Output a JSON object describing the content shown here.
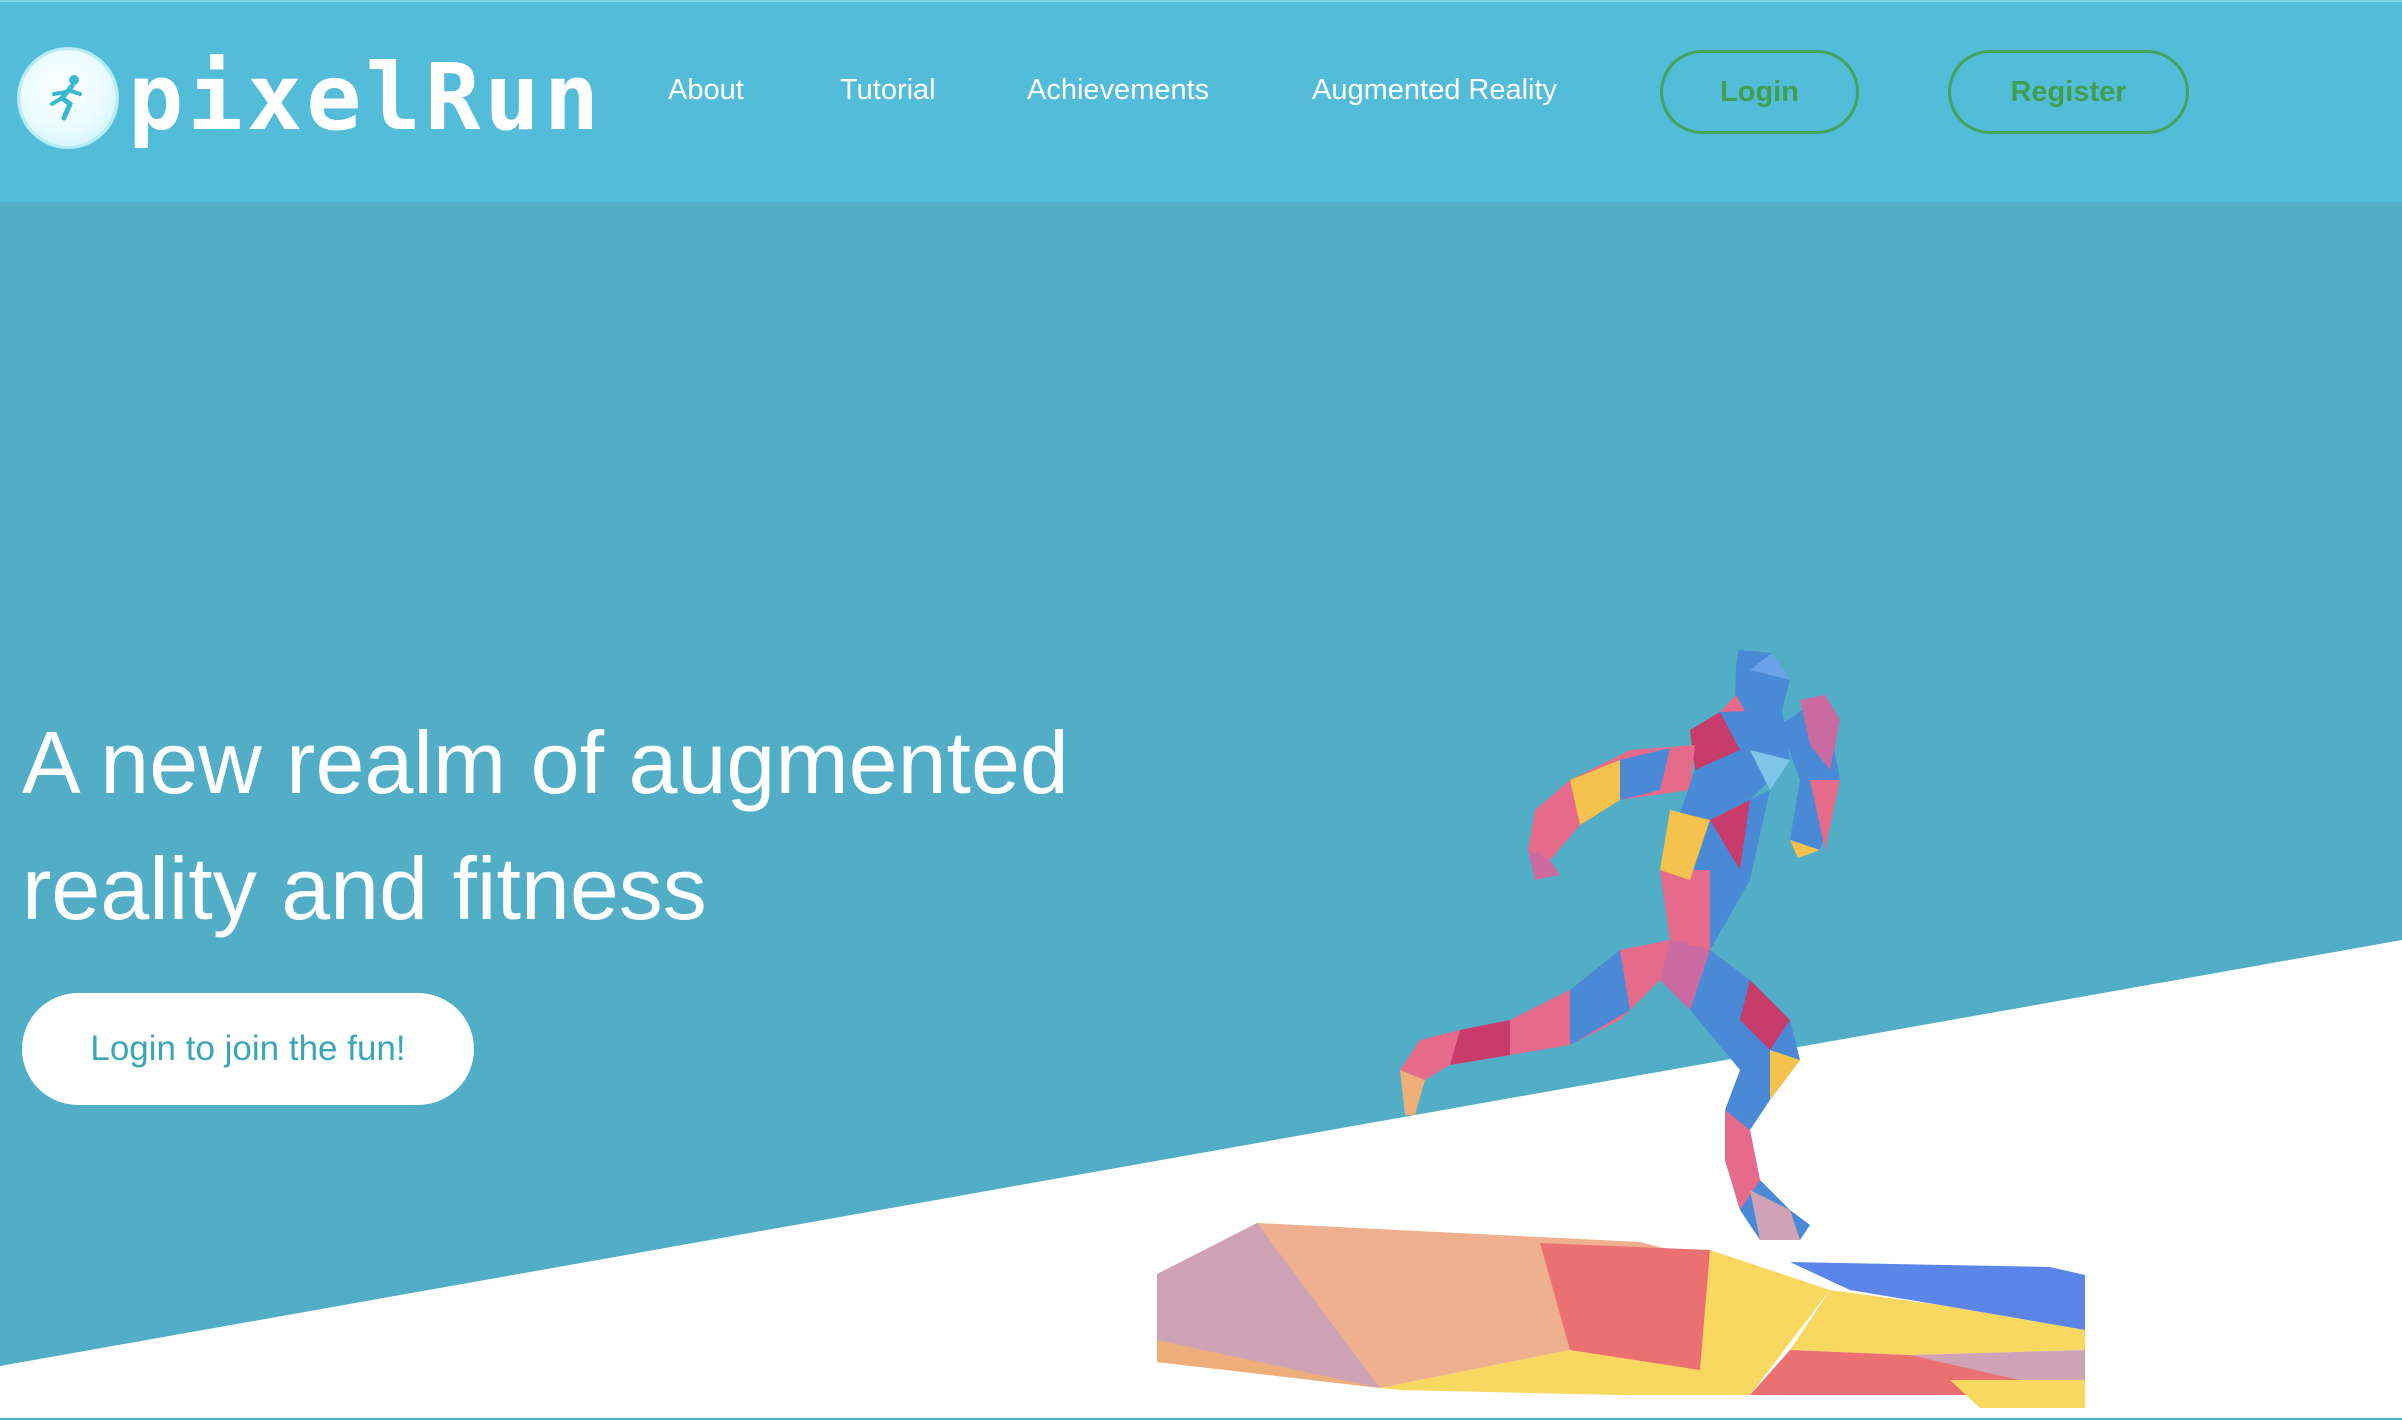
{
  "brand": {
    "name": "pixelRun"
  },
  "nav": {
    "links": [
      "About",
      "Tutorial",
      "Achievements",
      "Augmented Reality"
    ],
    "login_label": "Login",
    "register_label": "Register"
  },
  "hero": {
    "title": "A new realm of augmented reality and fitness",
    "cta_label": "Login to join the fun!"
  },
  "colors": {
    "navbar": "#52bcd9",
    "hero_bg": "#52aec6",
    "button_outline": "#3fa55a",
    "cta_text": "#3aa6b8"
  },
  "icons": {
    "logo": "runner-logo-icon"
  }
}
